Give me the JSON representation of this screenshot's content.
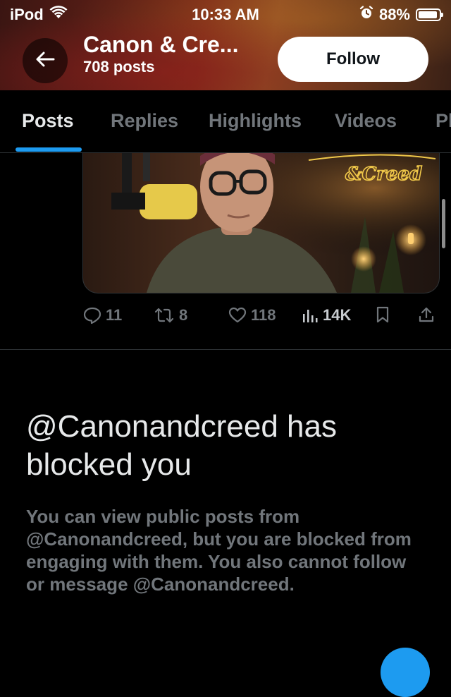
{
  "status_bar": {
    "carrier": "iPod",
    "time": "10:33 AM",
    "battery": "88%"
  },
  "header": {
    "title": "Canon & Cre...",
    "post_count": "708 posts",
    "follow_label": "Follow"
  },
  "tabs": [
    {
      "label": "Posts",
      "active": true
    },
    {
      "label": "Replies",
      "active": false
    },
    {
      "label": "Highlights",
      "active": false
    },
    {
      "label": "Videos",
      "active": false
    },
    {
      "label": "Pl",
      "active": false
    }
  ],
  "media": {
    "sign_text": "&Creed"
  },
  "post_actions": {
    "replies": "11",
    "reposts": "8",
    "likes": "118",
    "views": "14K"
  },
  "blocked": {
    "title": "@Canonandcreed has blocked you",
    "description": "You can view public posts from @Canonandcreed, but you are blocked from engaging with them. You also cannot follow or message @Canonandcreed."
  },
  "colors": {
    "accent": "#1d9bf0",
    "background": "#000000",
    "muted_text": "#71767b"
  }
}
